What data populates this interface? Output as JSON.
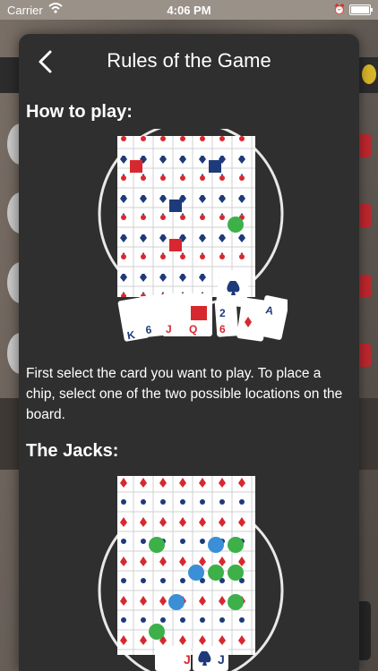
{
  "status_bar": {
    "carrier": "Carrier",
    "time": "4:06 PM"
  },
  "modal": {
    "title": "Rules of the Game",
    "sections": [
      {
        "heading": "How to play:",
        "text": "First select the card you want to play. To place a chip, select one of the two possible locations on the board."
      },
      {
        "heading": "The Jacks:"
      }
    ]
  },
  "icons": {
    "back": "chevron-left-icon",
    "wifi": "wifi-icon",
    "battery": "battery-icon"
  },
  "colors": {
    "modal_bg": "#2f2f2f",
    "card_red": "#d8282f",
    "card_blue": "#1e3a7a",
    "chip_green": "#3db04a",
    "chip_blue": "#3b8fd6"
  },
  "illustrations": {
    "hand_cards_how_to_play": [
      "K",
      "6",
      "J",
      "Q",
      "2",
      "6",
      "A"
    ],
    "hand_cards_jacks": [
      "J",
      "J"
    ]
  }
}
